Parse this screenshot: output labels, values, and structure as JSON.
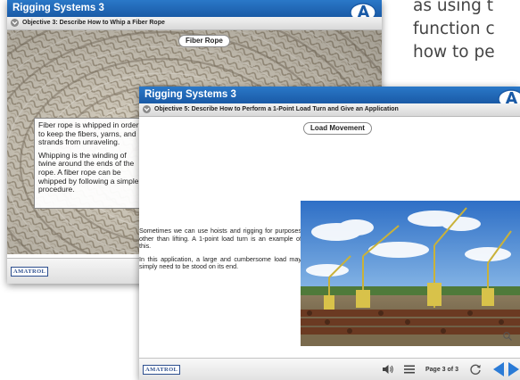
{
  "background": {
    "lines": [
      "as using t",
      "function c",
      "how to pe"
    ]
  },
  "window1": {
    "title": "Rigging Systems 3",
    "objective": "Objective 3: Describe How to Whip a Fiber Rope",
    "pill": "Fiber Rope",
    "paragraphs": [
      "Fiber rope is whipped in order to keep the fibers, yarns, and strands from unraveling.",
      "Whipping is the winding of twine around the ends of the rope. A fiber rope can be whipped by following a simple procedure."
    ],
    "footer_logo": "AMATROL"
  },
  "window2": {
    "title": "Rigging Systems 3",
    "objective": "Objective 5: Describe How to Perform a 1-Point Load Turn and Give an Application",
    "pill": "Load Movement",
    "paragraphs": [
      "Sometimes we can use hoists and rigging for purposes other than lifting. A 1-point load turn is an example of this.",
      "In this application, a large and cumbersome load may simply need to be stood on its end."
    ],
    "footer_logo": "AMATROL",
    "page_indicator": "Page 3 of 3"
  },
  "icons": {
    "logo": "amatrol-a-logo-icon",
    "menu": "hamburger-menu-icon",
    "volume": "volume-icon",
    "refresh": "refresh-icon",
    "prev": "back-arrow-icon",
    "next": "next-arrow-icon",
    "zoom": "zoom-icon"
  },
  "colors": {
    "title_blue": "#1f66b4",
    "nav_blue": "#2b7bd6"
  }
}
